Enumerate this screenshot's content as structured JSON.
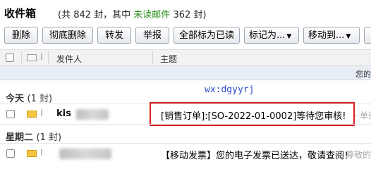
{
  "header": {
    "title": "收件箱",
    "meta_prefix": "(共 842 封，其中 ",
    "unread_label": "未读邮件",
    "meta_suffix": " 362 封)"
  },
  "toolbar": {
    "delete": "删除",
    "delete_forever": "彻底删除",
    "forward": "转发",
    "report": "举报",
    "mark_all_read": "全部标为已读",
    "mark_as": "标记为...",
    "move_to": "移动到..."
  },
  "columns": {
    "sender": "发件人",
    "subject": "主题"
  },
  "info_strip": "您的",
  "watermark": "wx:dgyyrj",
  "groups": [
    {
      "label": "今天",
      "count": "(1 封)"
    },
    {
      "label": "星期二",
      "count": "(1 封)"
    }
  ],
  "emails": [
    {
      "sender_visible": "kis",
      "subject": "[销售订单]:[SO-2022-01-0002]等待您审核!",
      "preview": "- 单据"
    },
    {
      "sender_visible": "",
      "subject": "【移动发票】您的电子发票已送达，敬请查阅！",
      "preview": "- 尊敬的"
    }
  ]
}
